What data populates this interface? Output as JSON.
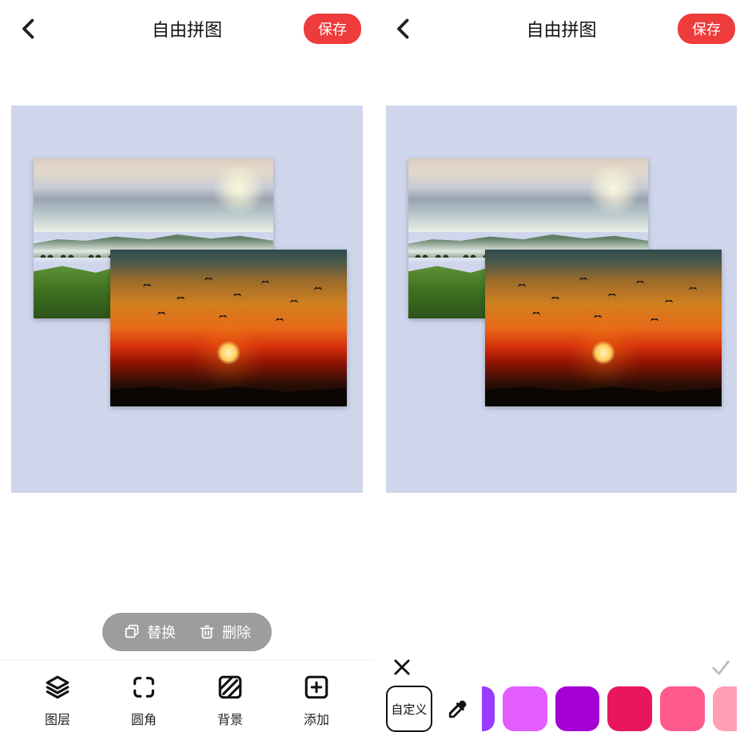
{
  "header": {
    "title": "自由拼图",
    "save_label": "保存",
    "back_icon": "chevron-left-icon"
  },
  "action_pill": {
    "replace_label": "替换",
    "delete_label": "删除"
  },
  "tools": [
    {
      "id": "layers",
      "label": "图层",
      "icon": "layers-icon"
    },
    {
      "id": "corner",
      "label": "圆角",
      "icon": "corner-radius-icon"
    },
    {
      "id": "background",
      "label": "背景",
      "icon": "background-icon"
    },
    {
      "id": "add",
      "label": "添加",
      "icon": "plus-square-icon"
    }
  ],
  "color_panel": {
    "close_icon": "close-icon",
    "confirm_icon": "check-icon",
    "custom_label": "自定义",
    "eyedropper_icon": "eyedropper-icon",
    "swatches": [
      {
        "color": "#9a3cff",
        "partial": "left"
      },
      {
        "color": "#e35cff"
      },
      {
        "color": "#a400d6"
      },
      {
        "color": "#e8175d"
      },
      {
        "color": "#ff5a8c"
      },
      {
        "color": "#ff9fb6",
        "partial": "right"
      }
    ]
  },
  "canvas": {
    "background_color": "#cfd6ec",
    "photos": [
      {
        "id": "hills",
        "name": "landscape-hills-photo"
      },
      {
        "id": "sunset",
        "name": "sunset-birds-photo"
      }
    ]
  }
}
